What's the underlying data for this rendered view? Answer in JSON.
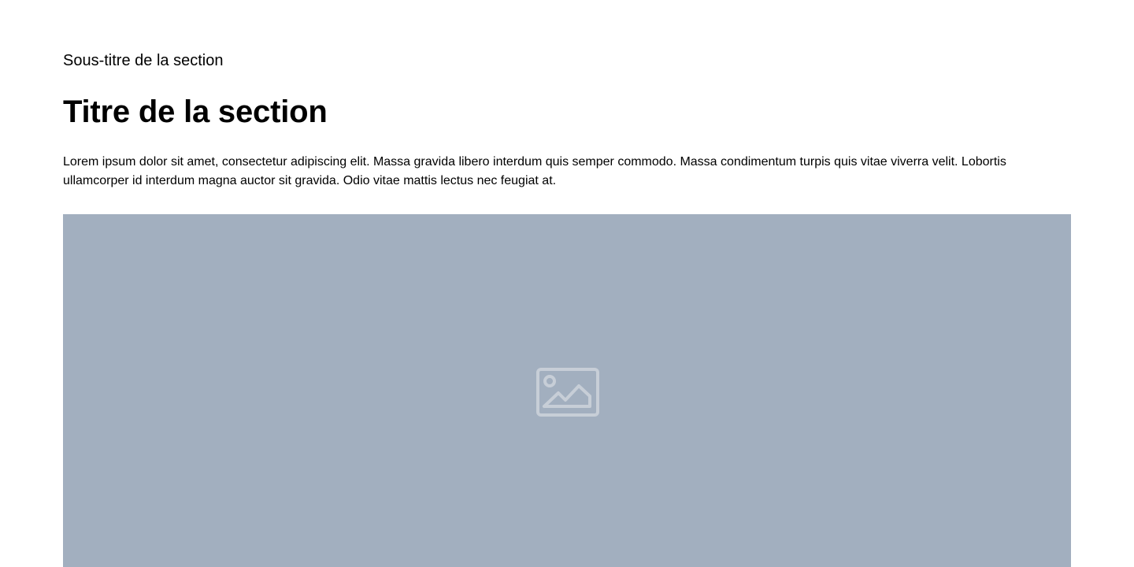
{
  "section": {
    "subtitle": "Sous-titre de la section",
    "title": "Titre de la section",
    "body": "Lorem ipsum dolor sit amet, consectetur adipiscing elit. Massa gravida libero interdum quis semper commodo. Massa condimentum turpis quis vitae viverra velit. Lobortis ullamcorper id interdum magna auctor sit gravida. Odio vitae mattis lectus nec feugiat at.",
    "image": {
      "icon": "image-icon",
      "background_color": "#a2afbf",
      "icon_color": "#c7ced7"
    }
  }
}
